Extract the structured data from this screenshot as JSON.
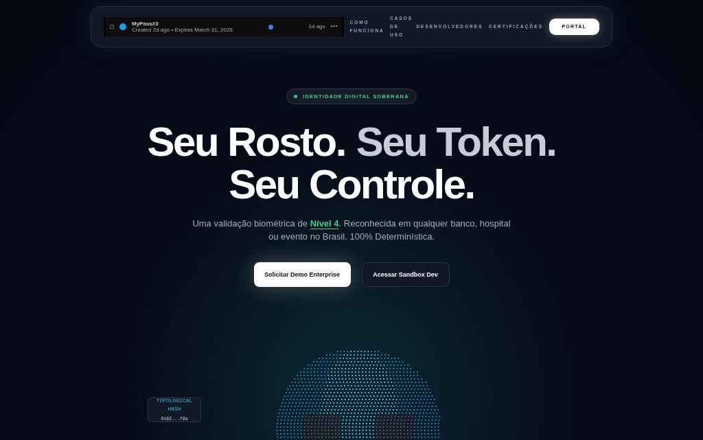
{
  "nav": {
    "pass_row": {
      "checked": false,
      "title": "MyPass#3",
      "subtitle": "Created 2d ago • Expires March 31, 2026",
      "time": "1d ago",
      "menu": "···"
    },
    "links": [
      {
        "label": "COMO FUNCIONA"
      },
      {
        "label": "CASOS DE USO"
      },
      {
        "label": "DESENVOLVEDORES"
      },
      {
        "label": "CERTIFICAÇÕES"
      }
    ],
    "cta": "PORTAL"
  },
  "hero": {
    "badge": "IDENTIDADE DIGITAL SOBERANA",
    "headline": [
      [
        {
          "text": "Seu Rosto.",
          "muted": false
        },
        {
          "text": "Seu Token.",
          "muted": true
        }
      ],
      [
        {
          "text": "Seu Controle.",
          "muted": false
        }
      ]
    ],
    "subtitle": "Uma validação biométrica de **Nível 4**. Reconhecida em qualquer banco, hospital ou evento no Brasil. 100% Determinística.",
    "buttons": [
      {
        "label": "Solicitar Demo Enterprise",
        "kind": "primary"
      },
      {
        "label": "Acessar Sandbox Dev",
        "kind": "secondary"
      }
    ],
    "hash_card": {
      "label": "TOPOLOGICAL HASH",
      "value": "0x82...f9a"
    }
  }
}
